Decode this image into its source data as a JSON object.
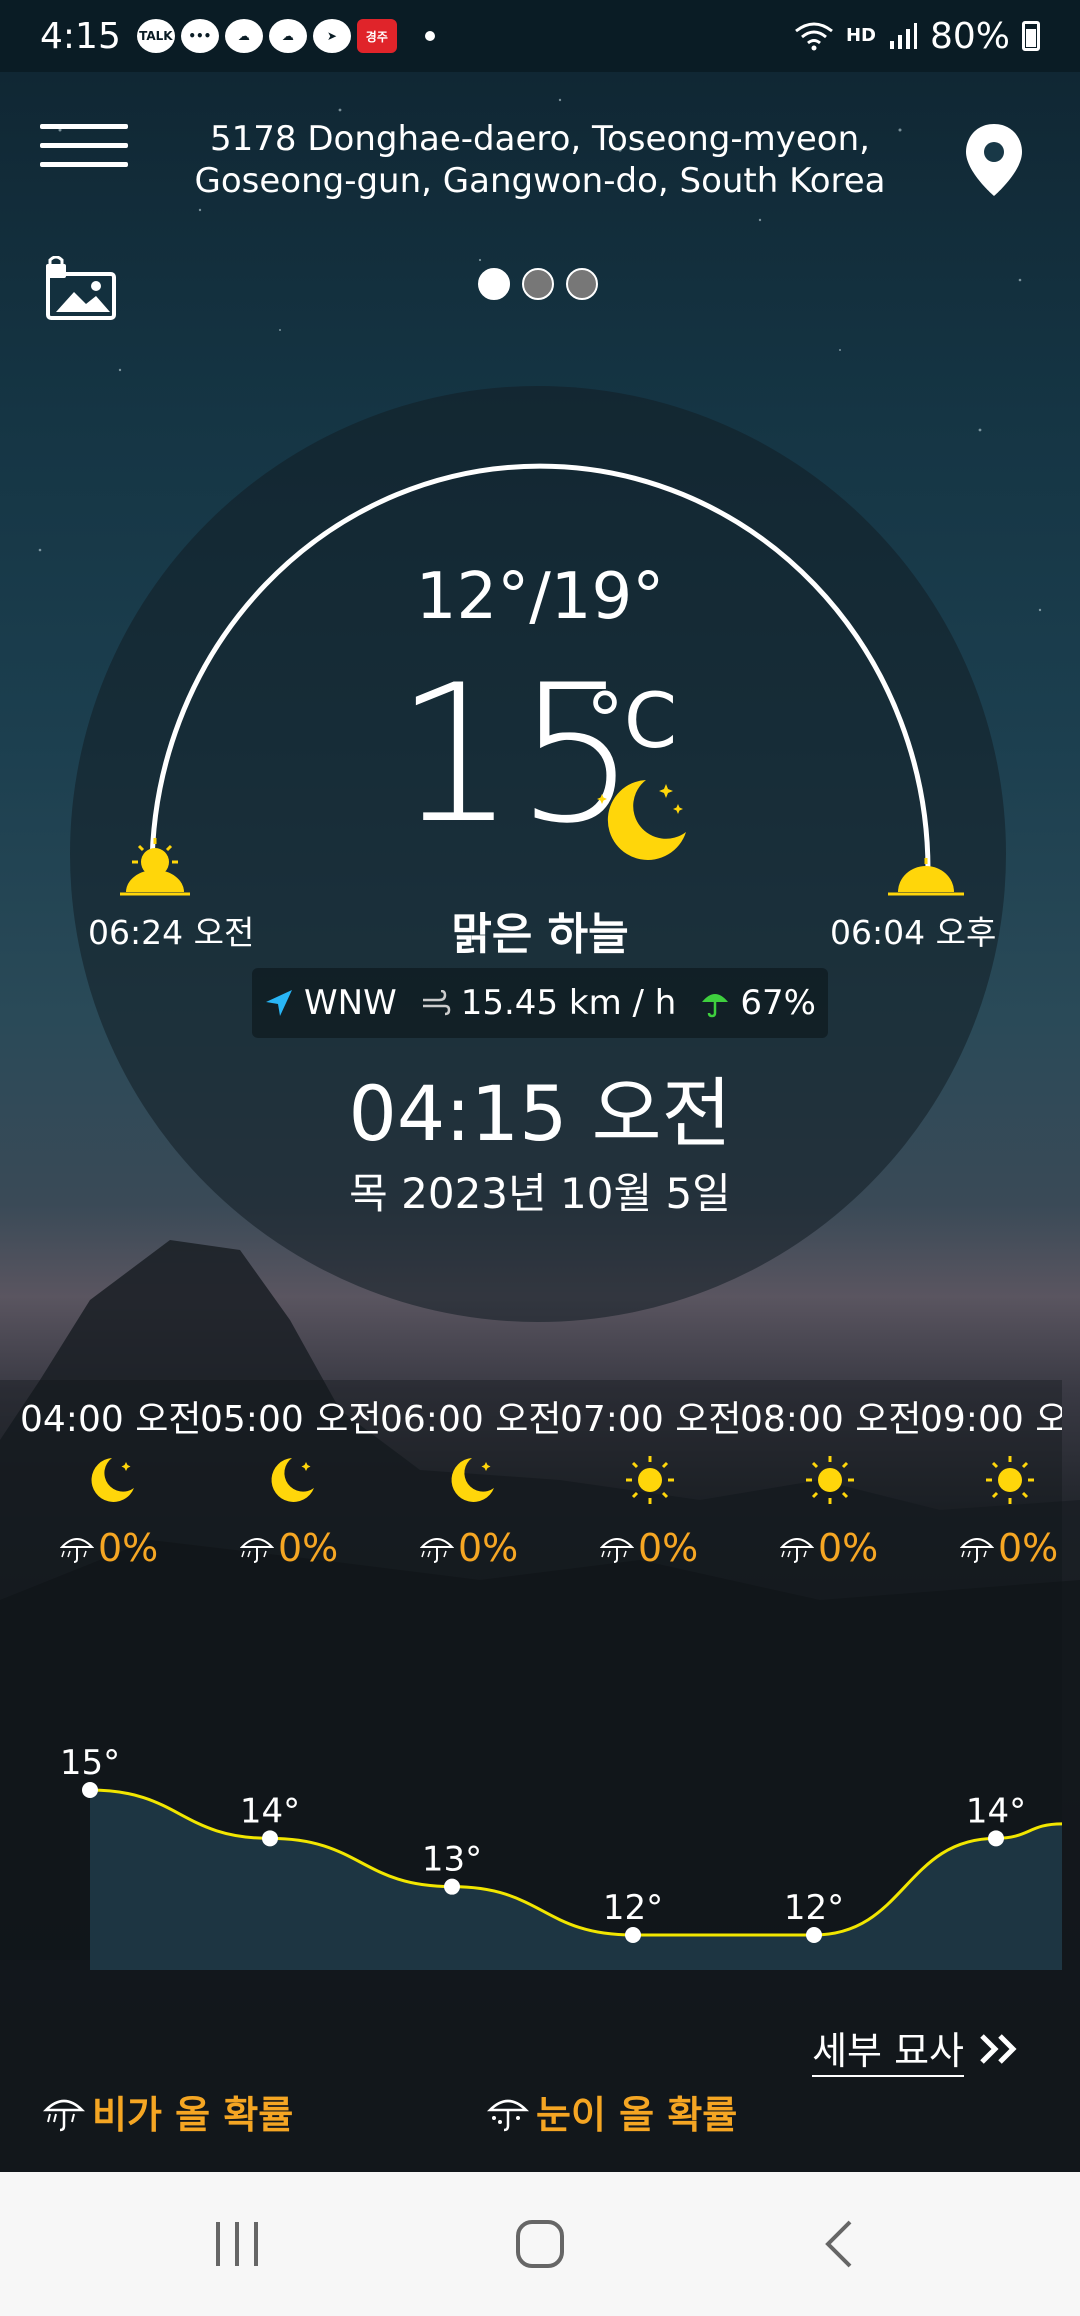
{
  "status_bar": {
    "time": "4:15",
    "notif_talk": "TALK",
    "notif_news": "경주",
    "battery": "80%",
    "network": "HD"
  },
  "header": {
    "address_line1": "5178 Donghae-daero, Toseong-myeon,",
    "address_line2": "Goseong-gun, Gangwon-do, South Korea",
    "page_count": 3,
    "active_page": 1
  },
  "current": {
    "min_max": "12°/19°",
    "temperature": "15",
    "unit": "°C",
    "condition": "맑은 하늘",
    "sunrise": "06:24 오전",
    "sunset": "06:04 오후",
    "wind_dir": "WNW",
    "wind_speed": "15.45 km / h",
    "precip": "67%",
    "clock": "04:15 오전",
    "date": "목 2023년 10월 5일"
  },
  "hourly": [
    {
      "time": "04:00 오전",
      "icon": "moon-icon",
      "pop": "0%",
      "temp": "15°",
      "value": 15
    },
    {
      "time": "05:00 오전",
      "icon": "moon-icon",
      "pop": "0%",
      "temp": "14°",
      "value": 14
    },
    {
      "time": "06:00 오전",
      "icon": "moon-icon",
      "pop": "0%",
      "temp": "13°",
      "value": 13
    },
    {
      "time": "07:00 오전",
      "icon": "sun-icon",
      "pop": "0%",
      "temp": "12°",
      "value": 12
    },
    {
      "time": "08:00 오전",
      "icon": "sun-icon",
      "pop": "0%",
      "temp": "12°",
      "value": 12
    },
    {
      "time": "09:00 오",
      "icon": "sun-icon",
      "pop": "0%",
      "temp": "14°",
      "value": 14
    }
  ],
  "footer": {
    "detail_label": "세부 묘사",
    "rain_label": "비가 올 확률",
    "snow_label": "눈이 올 확률"
  },
  "colors": {
    "accent_orange": "#f5a623",
    "sun_yellow": "#ffd60a",
    "chart_line": "#f2e600"
  }
}
